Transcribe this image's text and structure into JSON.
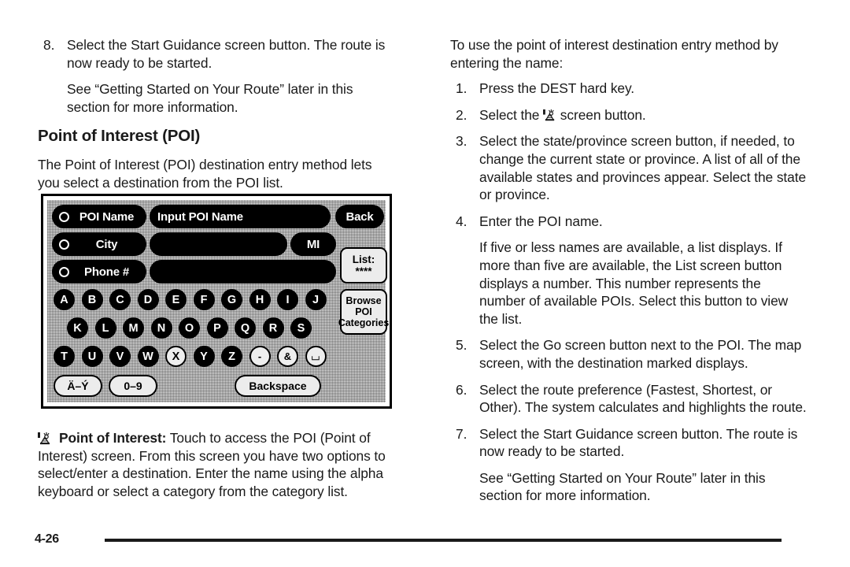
{
  "page": {
    "number": "4-26",
    "icon_names": [
      "poi-icon"
    ]
  },
  "left_column": {
    "step8": {
      "num": "8.",
      "text": "Select the Start Guidance screen button. The route is now ready to be started."
    },
    "step8_note": "See “Getting Started on Your Route” later in this section for more information.",
    "heading": "Point of Interest (POI)",
    "intro": "The Point of Interest (POI) destination entry method lets you select a destination from the POI list."
  },
  "nav_screen": {
    "rows": [
      {
        "label": "POI Name",
        "field_value": "Input POI Name",
        "side_button": "Back"
      },
      {
        "label": "City",
        "field_value": "",
        "side_button": "MI"
      },
      {
        "label": "Phone #",
        "field_value": "",
        "side_button": ""
      }
    ],
    "list_button": {
      "line1": "List:",
      "line2": "****"
    },
    "browse_button": {
      "line1": "Browse",
      "line2": "POI",
      "line3": "Categories"
    },
    "keyboard": {
      "row1": [
        {
          "key": "A",
          "state": "active"
        },
        {
          "key": "B",
          "state": "active"
        },
        {
          "key": "C",
          "state": "active"
        },
        {
          "key": "D",
          "state": "active"
        },
        {
          "key": "E",
          "state": "active"
        },
        {
          "key": "F",
          "state": "active"
        },
        {
          "key": "G",
          "state": "active"
        },
        {
          "key": "H",
          "state": "active"
        },
        {
          "key": "I",
          "state": "active"
        },
        {
          "key": "J",
          "state": "active"
        }
      ],
      "row2": [
        {
          "key": "K",
          "state": "active"
        },
        {
          "key": "L",
          "state": "active"
        },
        {
          "key": "M",
          "state": "active"
        },
        {
          "key": "N",
          "state": "active"
        },
        {
          "key": "O",
          "state": "active"
        },
        {
          "key": "P",
          "state": "active"
        },
        {
          "key": "Q",
          "state": "active"
        },
        {
          "key": "R",
          "state": "active"
        },
        {
          "key": "S",
          "state": "active"
        }
      ],
      "row3": [
        {
          "key": "T",
          "state": "active"
        },
        {
          "key": "U",
          "state": "active"
        },
        {
          "key": "V",
          "state": "active"
        },
        {
          "key": "W",
          "state": "active"
        },
        {
          "key": "X",
          "state": "dimmed"
        },
        {
          "key": "Y",
          "state": "active"
        },
        {
          "key": "Z",
          "state": "active"
        },
        {
          "key": "-",
          "state": "dimmed"
        },
        {
          "key": "&",
          "state": "dimmed"
        },
        {
          "key": "⌴",
          "state": "dimmed"
        }
      ],
      "row4": [
        {
          "key": "Ä–Ý",
          "state": "dimmed"
        },
        {
          "key": "0–9",
          "state": "dimmed"
        },
        {
          "key": "Backspace",
          "state": "dimmed"
        }
      ]
    }
  },
  "caption": {
    "icon": "poi-icon",
    "title": "Point of Interest:",
    "text": " Touch to access the POI (Point of Interest) screen. From this screen you have two options to select/enter a destination. Enter the name using the alpha keyboard or select a category from the category list."
  },
  "right_column": {
    "intro": "To use the point of interest destination entry method by entering the name:",
    "steps": [
      {
        "num": "1.",
        "text": "Press the DEST hard key."
      },
      {
        "num": "2.",
        "text_before": "Select the ",
        "icon": "poi-icon",
        "text_after": " screen button."
      },
      {
        "num": "3.",
        "text": "Select the state/province screen button, if needed, to change the current state or province. A list of all of the available states and provinces appear. Select the state or province."
      },
      {
        "num": "4.",
        "text": "Enter the POI name."
      },
      {
        "num": "5.",
        "text": "Select the Go screen button next to the POI. The map screen, with the destination marked displays."
      },
      {
        "num": "6.",
        "text": "Select the route preference (Fastest, Shortest, or Other). The system calculates and highlights the route."
      },
      {
        "num": "7.",
        "text": "Select the Start Guidance screen button. The route is now ready to be started."
      }
    ],
    "step4_note": "If five or less names are available, a list displays. If more than five are available, the List screen button displays a number. This number represents the number of available POIs. Select this button to view the list.",
    "step7_note": "See “Getting Started on Your Route” later in this section for more information."
  }
}
